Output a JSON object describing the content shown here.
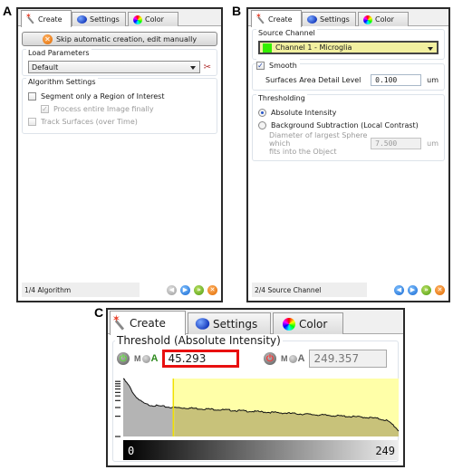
{
  "figure_labels": {
    "a": "A",
    "b": "B",
    "c": "C"
  },
  "tabs": [
    {
      "label": "Create",
      "icon": "wand-icon"
    },
    {
      "label": "Settings",
      "icon": "settings-blob-icon"
    },
    {
      "label": "Color",
      "icon": "color-wheel-icon"
    }
  ],
  "panel_a": {
    "skip_button": "Skip automatic creation, edit manually",
    "load_parameters": {
      "title": "Load Parameters",
      "selected": "Default"
    },
    "algorithm_settings": {
      "title": "Algorithm Settings",
      "options": [
        {
          "label": "Segment only a Region of Interest",
          "checked": false,
          "enabled": true
        },
        {
          "label": "Process entire Image finally",
          "checked": true,
          "enabled": false
        },
        {
          "label": "Track Surfaces (over Time)",
          "checked": false,
          "enabled": false
        }
      ]
    },
    "status": "1/4 Algorithm"
  },
  "panel_b": {
    "source_channel": {
      "title": "Source Channel",
      "selected": "Channel 1 - Microglia",
      "channel_color": "#33ee00"
    },
    "smooth": {
      "label": "Smooth",
      "checked": true,
      "detail_label": "Surfaces Area Detail Level",
      "detail_value": "0.100",
      "unit": "um"
    },
    "thresholding": {
      "title": "Thresholding",
      "options": [
        {
          "label": "Absolute Intensity",
          "selected": true
        },
        {
          "label": "Background Subtraction (Local Contrast)",
          "selected": false
        }
      ],
      "diameter_label_1": "Diameter of largest Sphere which",
      "diameter_label_2": "fits into the Object",
      "diameter_value": "7.500",
      "unit": "um"
    },
    "status": "2/4 Source Channel"
  },
  "panel_c": {
    "threshold_title": "Threshold (Absolute Intensity)",
    "low_value": "45.293",
    "high_value": "249.357",
    "ma_label_m": "M",
    "ma_label_a": "A",
    "gradient_min": "0",
    "gradient_max": "249",
    "colors": {
      "highlight_border": "#e81010",
      "selected_region": "#ffffa8",
      "threshold_line": "#f0e000"
    }
  },
  "chart_data": {
    "type": "area",
    "title": "Threshold (Absolute Intensity)",
    "xlabel": "",
    "ylabel": "",
    "xlim": [
      0,
      249
    ],
    "scale": "log",
    "threshold_low": 45.293,
    "threshold_high": 249.357,
    "x": [
      0,
      5,
      10,
      15,
      20,
      25,
      30,
      35,
      40,
      45,
      60,
      80,
      100,
      120,
      140,
      160,
      180,
      200,
      220,
      230,
      238,
      244,
      249
    ],
    "y_rel": [
      1.0,
      0.88,
      0.72,
      0.62,
      0.56,
      0.54,
      0.53,
      0.52,
      0.51,
      0.5,
      0.49,
      0.47,
      0.45,
      0.43,
      0.41,
      0.39,
      0.37,
      0.35,
      0.33,
      0.31,
      0.28,
      0.2,
      0.1
    ]
  }
}
